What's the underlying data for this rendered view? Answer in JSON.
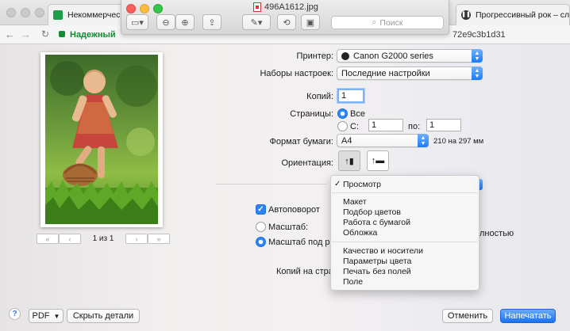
{
  "browser": {
    "tab1": "Некоммерческа",
    "tab2": "Прогрессивный рок – слу",
    "url_secure": "Надежный",
    "url_tail": "72e9c3b1d31"
  },
  "preview": {
    "title": "496A1612.jpg",
    "search_placeholder": "Поиск"
  },
  "print": {
    "page_indicator": "1 из 1",
    "printer_label": "Принтер:",
    "printer_value": "Canon G2000 series",
    "presets_label": "Наборы настроек:",
    "presets_value": "Последние настройки",
    "copies_label": "Копий:",
    "copies_value": "1",
    "pages_label": "Страницы:",
    "pages_all": "Все",
    "pages_from_label": "С:",
    "pages_from_value": "1",
    "pages_to_label": "по:",
    "pages_to_value": "1",
    "paper_label": "Формат бумаги:",
    "paper_value": "A4",
    "paper_size": "210 на 297 мм",
    "orientation_label": "Ориентация:",
    "autorotate_label": "Автоповорот",
    "scale_label": "Масштаб:",
    "scale_to_fit_label": "Масштаб под ра",
    "scale_fill_tail": "лностью",
    "copies_per_page_label": "Копий на стра"
  },
  "menu": {
    "selected": "Просмотр",
    "group1": [
      "Макет",
      "Подбор цветов",
      "Работа с бумагой",
      "Обложка"
    ],
    "group2": [
      "Качество и носители",
      "Параметры цвета",
      "Печать без полей",
      "Поле"
    ]
  },
  "footer": {
    "help": "?",
    "pdf": "PDF",
    "hide_details": "Скрыть детали",
    "cancel": "Отменить",
    "print": "Напечатать"
  }
}
